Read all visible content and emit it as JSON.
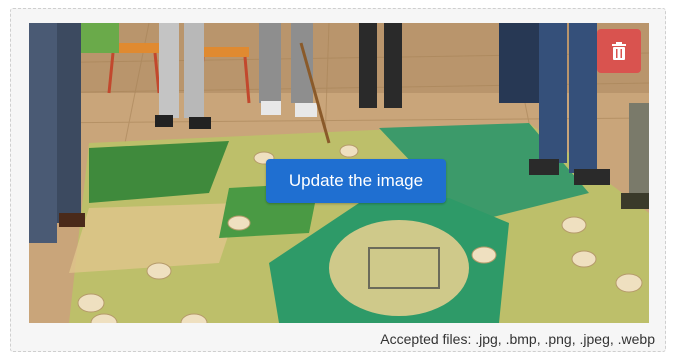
{
  "uploader": {
    "update_button_label": "Update the image",
    "accepted_files_text": "Accepted files:  .jpg, .bmp, .png, .jpeg, .webp",
    "delete_icon": "trash-icon",
    "photo_alt": "Children standing around an illustrated game mat on a wooden floor"
  },
  "colors": {
    "delete_button": "#d9534f",
    "update_button": "#1f6fd1"
  }
}
